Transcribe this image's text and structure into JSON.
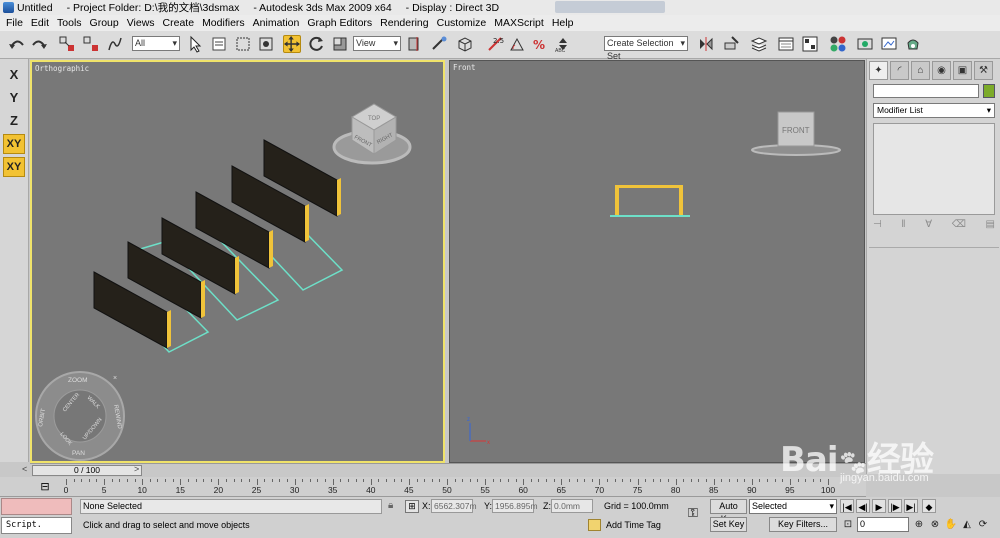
{
  "window": {
    "title_segments": [
      "Untitled",
      "- Project Folder: D:\\我的文档\\3dsmax",
      "- Autodesk 3ds Max  2009 x64",
      "- Display : Direct 3D"
    ]
  },
  "menu": [
    "File",
    "Edit",
    "Tools",
    "Group",
    "Views",
    "Create",
    "Modifiers",
    "Animation",
    "Graph Editors",
    "Rendering",
    "Customize",
    "MAXScript",
    "Help"
  ],
  "toolbar": {
    "selection_filter": "All",
    "reference_coord": "View",
    "named_selection_placeholder": "Create Selection Set"
  },
  "axis_constraints": [
    {
      "label": "X",
      "active": false
    },
    {
      "label": "Y",
      "active": false
    },
    {
      "label": "Z",
      "active": false
    },
    {
      "label": "XY",
      "active": true
    },
    {
      "label": "XY",
      "active": true
    }
  ],
  "viewports": {
    "ortho": {
      "label": "Orthographic",
      "viewcube_faces": [
        "TOP",
        "FRONT",
        "RIGHT"
      ],
      "wheel": {
        "zoom": "ZOOM",
        "orbit": "ORBIT",
        "center": "CENTER",
        "walk": "WALK",
        "rewind": "REWIND",
        "look": "LOOK",
        "updown": "UP/DOWN",
        "pan": "PAN"
      }
    },
    "front": {
      "label": "Front",
      "viewcube_face": "FRONT"
    }
  },
  "command_panel": {
    "modifier_list": "Modifier List",
    "object_color": "#7cab2a"
  },
  "time": {
    "slider_label": "0 / 100",
    "ticks": [
      0,
      5,
      10,
      15,
      20,
      25,
      30,
      35,
      40,
      45,
      50,
      55,
      60,
      65,
      70,
      75,
      80,
      85,
      90,
      95,
      100
    ]
  },
  "status": {
    "script_label": "Script.",
    "selection_info": "None Selected",
    "prompt": "Click and drag to select and move objects",
    "x_label": "X:",
    "x_value": "6562.307m",
    "y_label": "Y:",
    "y_value": "1956.895m",
    "z_label": "Z:",
    "z_value": "0.0mm",
    "grid": "Grid = 100.0mm",
    "add_time_tag": "Add Time Tag",
    "auto_key": "Auto Key",
    "set_key": "Set Key",
    "selected": "Selected",
    "key_filters": "Key Filters...",
    "current_frame": "0"
  },
  "watermark": {
    "brand": "Bai",
    "brand2": "经验",
    "site": "jingyan.baidu.com"
  }
}
